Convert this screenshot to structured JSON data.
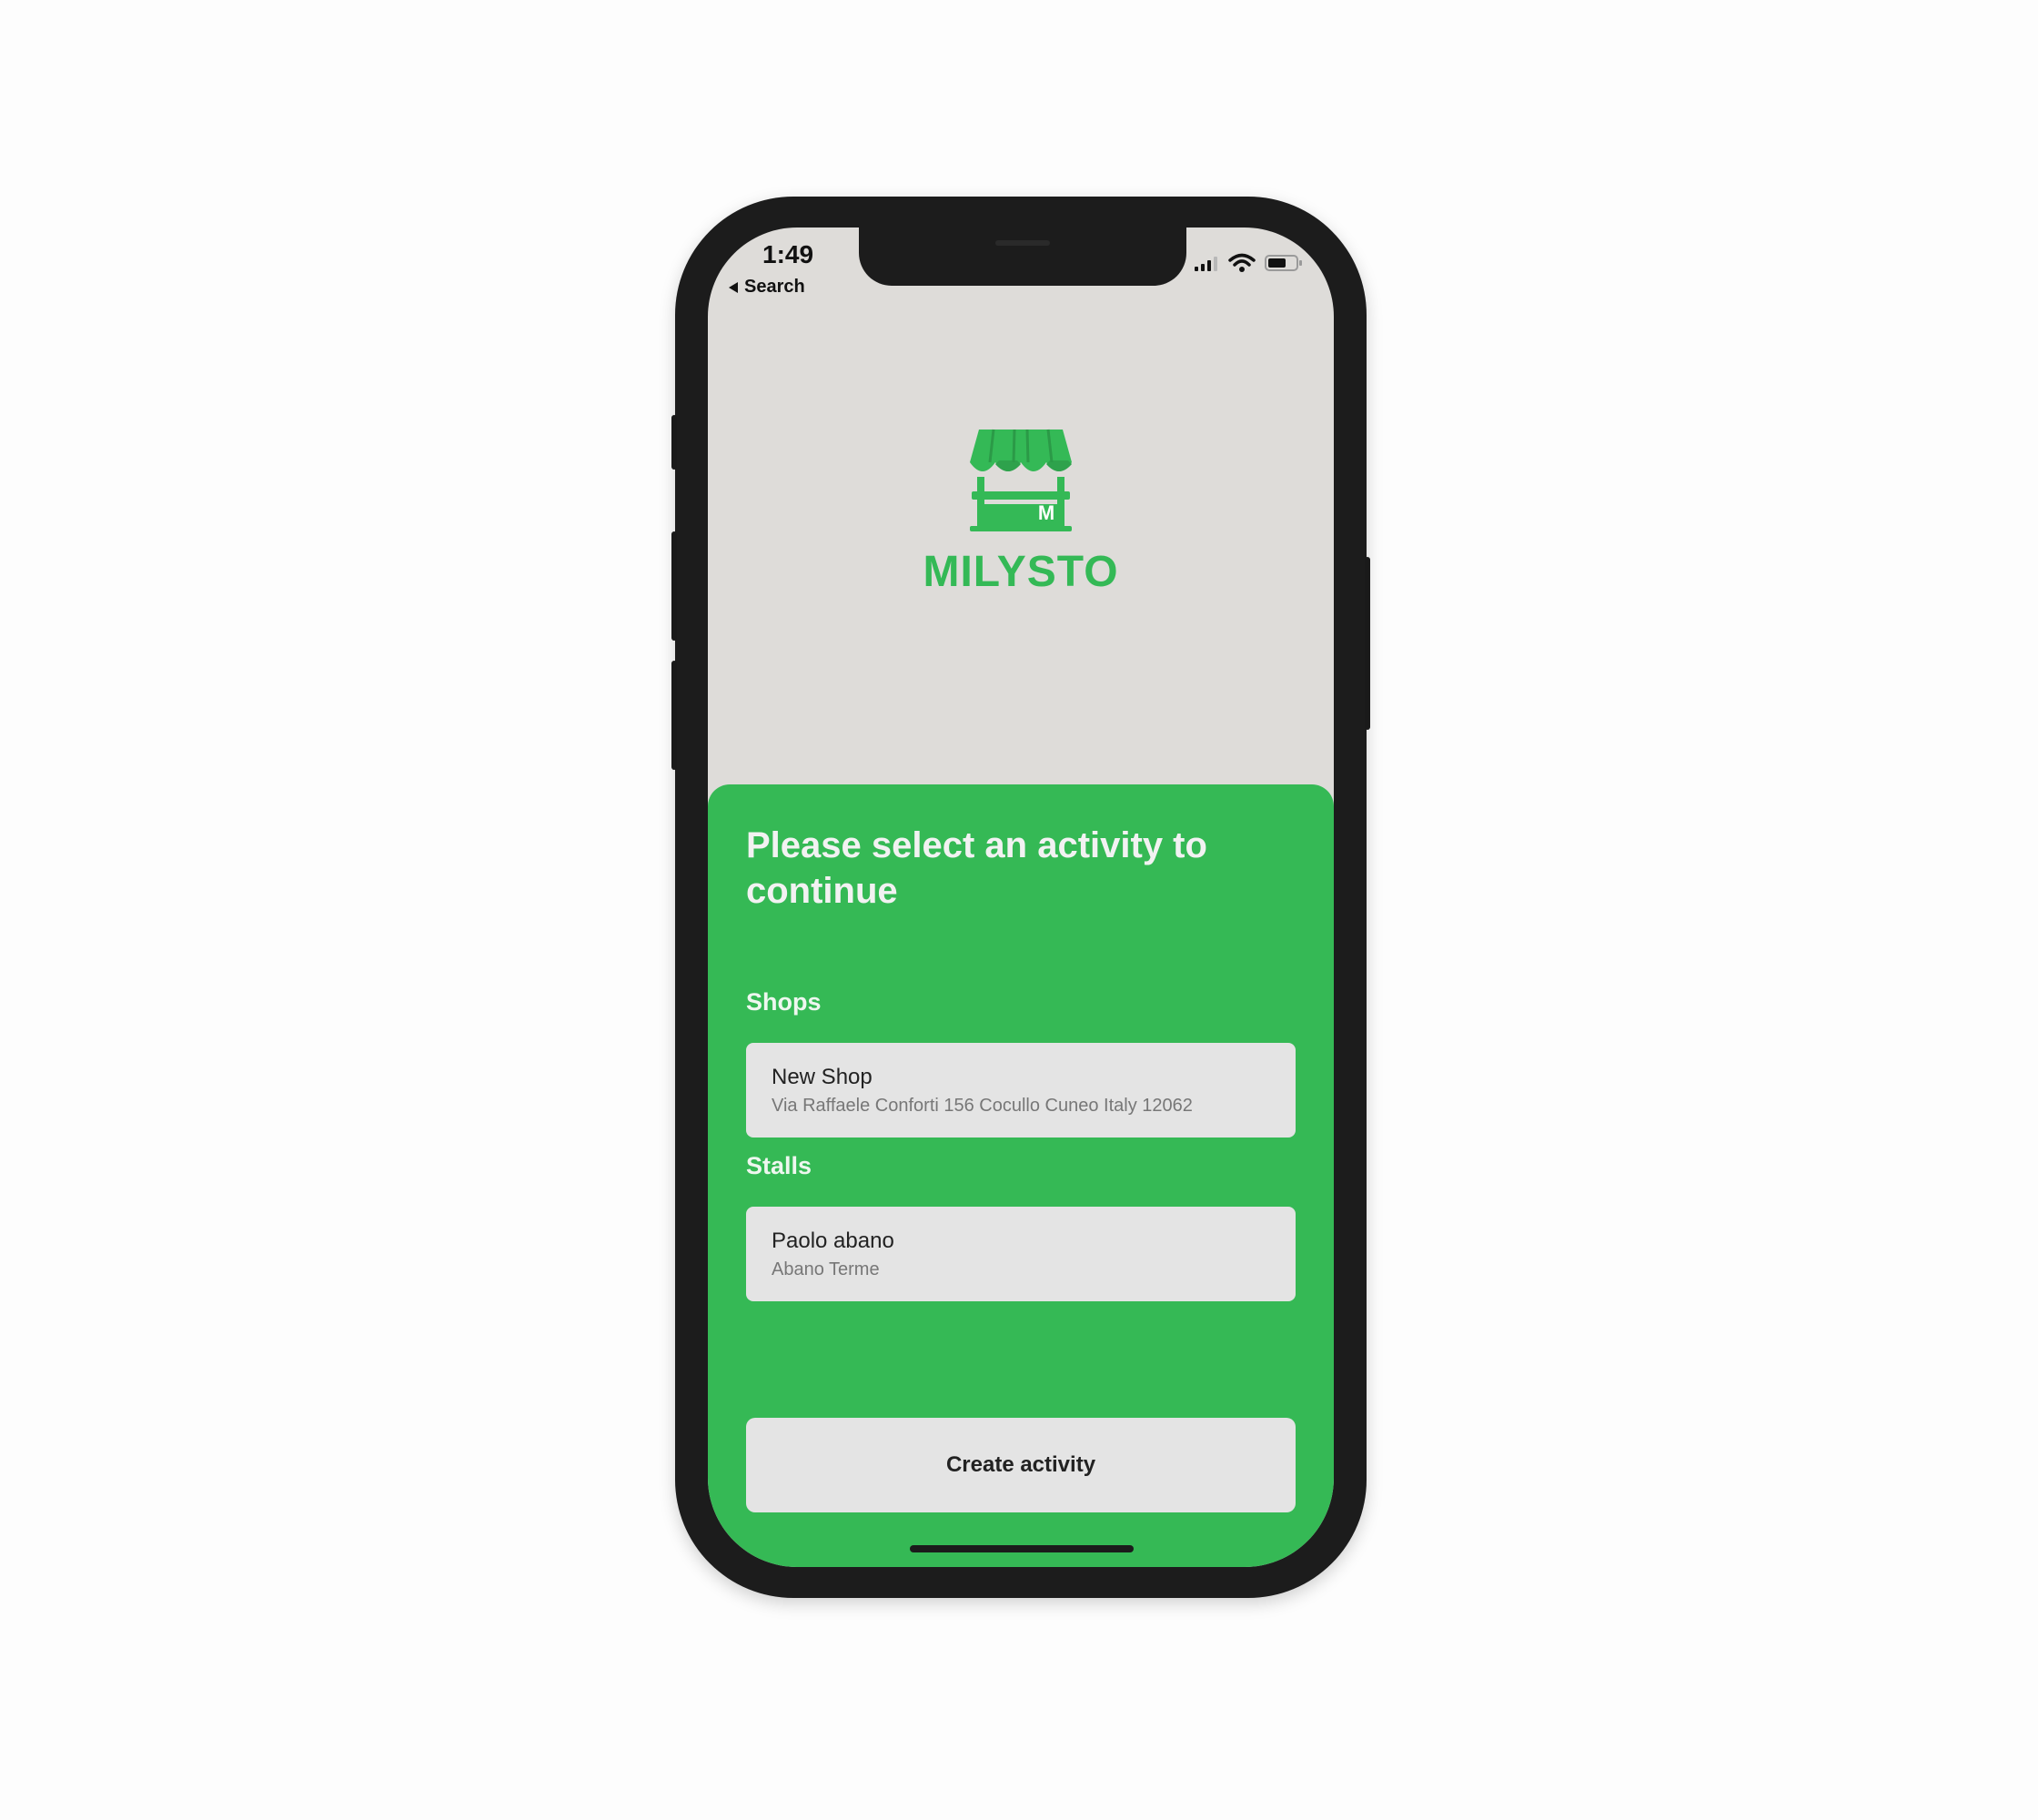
{
  "status_bar": {
    "time": "1:49",
    "back_label": "Search"
  },
  "brand": {
    "name": "MILYSTO",
    "badge_letter": "M",
    "color": "#34b956"
  },
  "sheet": {
    "title": "Please select an activity to continue",
    "shops_label": "Shops",
    "shops": [
      {
        "name": "New Shop",
        "address": "Via Raffaele Conforti 156 Cocullo Cuneo Italy 12062"
      }
    ],
    "stalls_label": "Stalls",
    "stalls": [
      {
        "name": "Paolo abano",
        "address": "Abano Terme"
      }
    ],
    "create_button": "Create activity"
  },
  "colors": {
    "sheet_background": "#35b955",
    "screen_background": "#dedcd9",
    "card_background": "#e4e4e4"
  }
}
